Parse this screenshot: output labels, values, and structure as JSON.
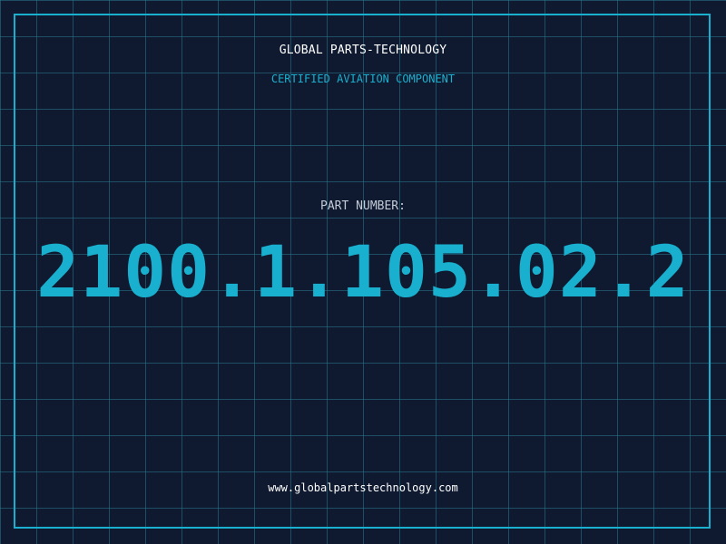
{
  "header": {
    "company": "GLOBAL PARTS-TECHNOLOGY",
    "tagline": "CERTIFIED AVIATION COMPONENT"
  },
  "part": {
    "label": "PART NUMBER:",
    "number": "2100.1.105.02.2"
  },
  "footer": {
    "website": "www.globalpartstechnology.com"
  },
  "colors": {
    "background": "#0f1a30",
    "accent": "#19b0cf",
    "text": "#ffffff",
    "label": "#c3ccd8"
  }
}
